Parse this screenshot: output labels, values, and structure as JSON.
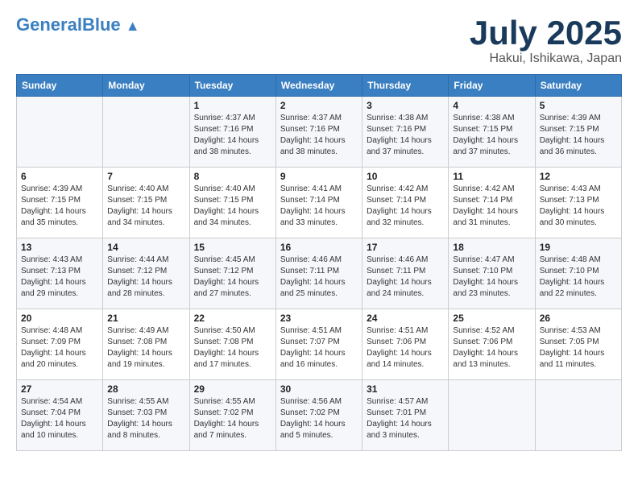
{
  "header": {
    "logo_general": "General",
    "logo_blue": "Blue",
    "title": "July 2025",
    "subtitle": "Hakui, Ishikawa, Japan"
  },
  "weekdays": [
    "Sunday",
    "Monday",
    "Tuesday",
    "Wednesday",
    "Thursday",
    "Friday",
    "Saturday"
  ],
  "weeks": [
    [
      {
        "day": "",
        "info": ""
      },
      {
        "day": "",
        "info": ""
      },
      {
        "day": "1",
        "info": "Sunrise: 4:37 AM\nSunset: 7:16 PM\nDaylight: 14 hours\nand 38 minutes."
      },
      {
        "day": "2",
        "info": "Sunrise: 4:37 AM\nSunset: 7:16 PM\nDaylight: 14 hours\nand 38 minutes."
      },
      {
        "day": "3",
        "info": "Sunrise: 4:38 AM\nSunset: 7:16 PM\nDaylight: 14 hours\nand 37 minutes."
      },
      {
        "day": "4",
        "info": "Sunrise: 4:38 AM\nSunset: 7:15 PM\nDaylight: 14 hours\nand 37 minutes."
      },
      {
        "day": "5",
        "info": "Sunrise: 4:39 AM\nSunset: 7:15 PM\nDaylight: 14 hours\nand 36 minutes."
      }
    ],
    [
      {
        "day": "6",
        "info": "Sunrise: 4:39 AM\nSunset: 7:15 PM\nDaylight: 14 hours\nand 35 minutes."
      },
      {
        "day": "7",
        "info": "Sunrise: 4:40 AM\nSunset: 7:15 PM\nDaylight: 14 hours\nand 34 minutes."
      },
      {
        "day": "8",
        "info": "Sunrise: 4:40 AM\nSunset: 7:15 PM\nDaylight: 14 hours\nand 34 minutes."
      },
      {
        "day": "9",
        "info": "Sunrise: 4:41 AM\nSunset: 7:14 PM\nDaylight: 14 hours\nand 33 minutes."
      },
      {
        "day": "10",
        "info": "Sunrise: 4:42 AM\nSunset: 7:14 PM\nDaylight: 14 hours\nand 32 minutes."
      },
      {
        "day": "11",
        "info": "Sunrise: 4:42 AM\nSunset: 7:14 PM\nDaylight: 14 hours\nand 31 minutes."
      },
      {
        "day": "12",
        "info": "Sunrise: 4:43 AM\nSunset: 7:13 PM\nDaylight: 14 hours\nand 30 minutes."
      }
    ],
    [
      {
        "day": "13",
        "info": "Sunrise: 4:43 AM\nSunset: 7:13 PM\nDaylight: 14 hours\nand 29 minutes."
      },
      {
        "day": "14",
        "info": "Sunrise: 4:44 AM\nSunset: 7:12 PM\nDaylight: 14 hours\nand 28 minutes."
      },
      {
        "day": "15",
        "info": "Sunrise: 4:45 AM\nSunset: 7:12 PM\nDaylight: 14 hours\nand 27 minutes."
      },
      {
        "day": "16",
        "info": "Sunrise: 4:46 AM\nSunset: 7:11 PM\nDaylight: 14 hours\nand 25 minutes."
      },
      {
        "day": "17",
        "info": "Sunrise: 4:46 AM\nSunset: 7:11 PM\nDaylight: 14 hours\nand 24 minutes."
      },
      {
        "day": "18",
        "info": "Sunrise: 4:47 AM\nSunset: 7:10 PM\nDaylight: 14 hours\nand 23 minutes."
      },
      {
        "day": "19",
        "info": "Sunrise: 4:48 AM\nSunset: 7:10 PM\nDaylight: 14 hours\nand 22 minutes."
      }
    ],
    [
      {
        "day": "20",
        "info": "Sunrise: 4:48 AM\nSunset: 7:09 PM\nDaylight: 14 hours\nand 20 minutes."
      },
      {
        "day": "21",
        "info": "Sunrise: 4:49 AM\nSunset: 7:08 PM\nDaylight: 14 hours\nand 19 minutes."
      },
      {
        "day": "22",
        "info": "Sunrise: 4:50 AM\nSunset: 7:08 PM\nDaylight: 14 hours\nand 17 minutes."
      },
      {
        "day": "23",
        "info": "Sunrise: 4:51 AM\nSunset: 7:07 PM\nDaylight: 14 hours\nand 16 minutes."
      },
      {
        "day": "24",
        "info": "Sunrise: 4:51 AM\nSunset: 7:06 PM\nDaylight: 14 hours\nand 14 minutes."
      },
      {
        "day": "25",
        "info": "Sunrise: 4:52 AM\nSunset: 7:06 PM\nDaylight: 14 hours\nand 13 minutes."
      },
      {
        "day": "26",
        "info": "Sunrise: 4:53 AM\nSunset: 7:05 PM\nDaylight: 14 hours\nand 11 minutes."
      }
    ],
    [
      {
        "day": "27",
        "info": "Sunrise: 4:54 AM\nSunset: 7:04 PM\nDaylight: 14 hours\nand 10 minutes."
      },
      {
        "day": "28",
        "info": "Sunrise: 4:55 AM\nSunset: 7:03 PM\nDaylight: 14 hours\nand 8 minutes."
      },
      {
        "day": "29",
        "info": "Sunrise: 4:55 AM\nSunset: 7:02 PM\nDaylight: 14 hours\nand 7 minutes."
      },
      {
        "day": "30",
        "info": "Sunrise: 4:56 AM\nSunset: 7:02 PM\nDaylight: 14 hours\nand 5 minutes."
      },
      {
        "day": "31",
        "info": "Sunrise: 4:57 AM\nSunset: 7:01 PM\nDaylight: 14 hours\nand 3 minutes."
      },
      {
        "day": "",
        "info": ""
      },
      {
        "day": "",
        "info": ""
      }
    ]
  ]
}
